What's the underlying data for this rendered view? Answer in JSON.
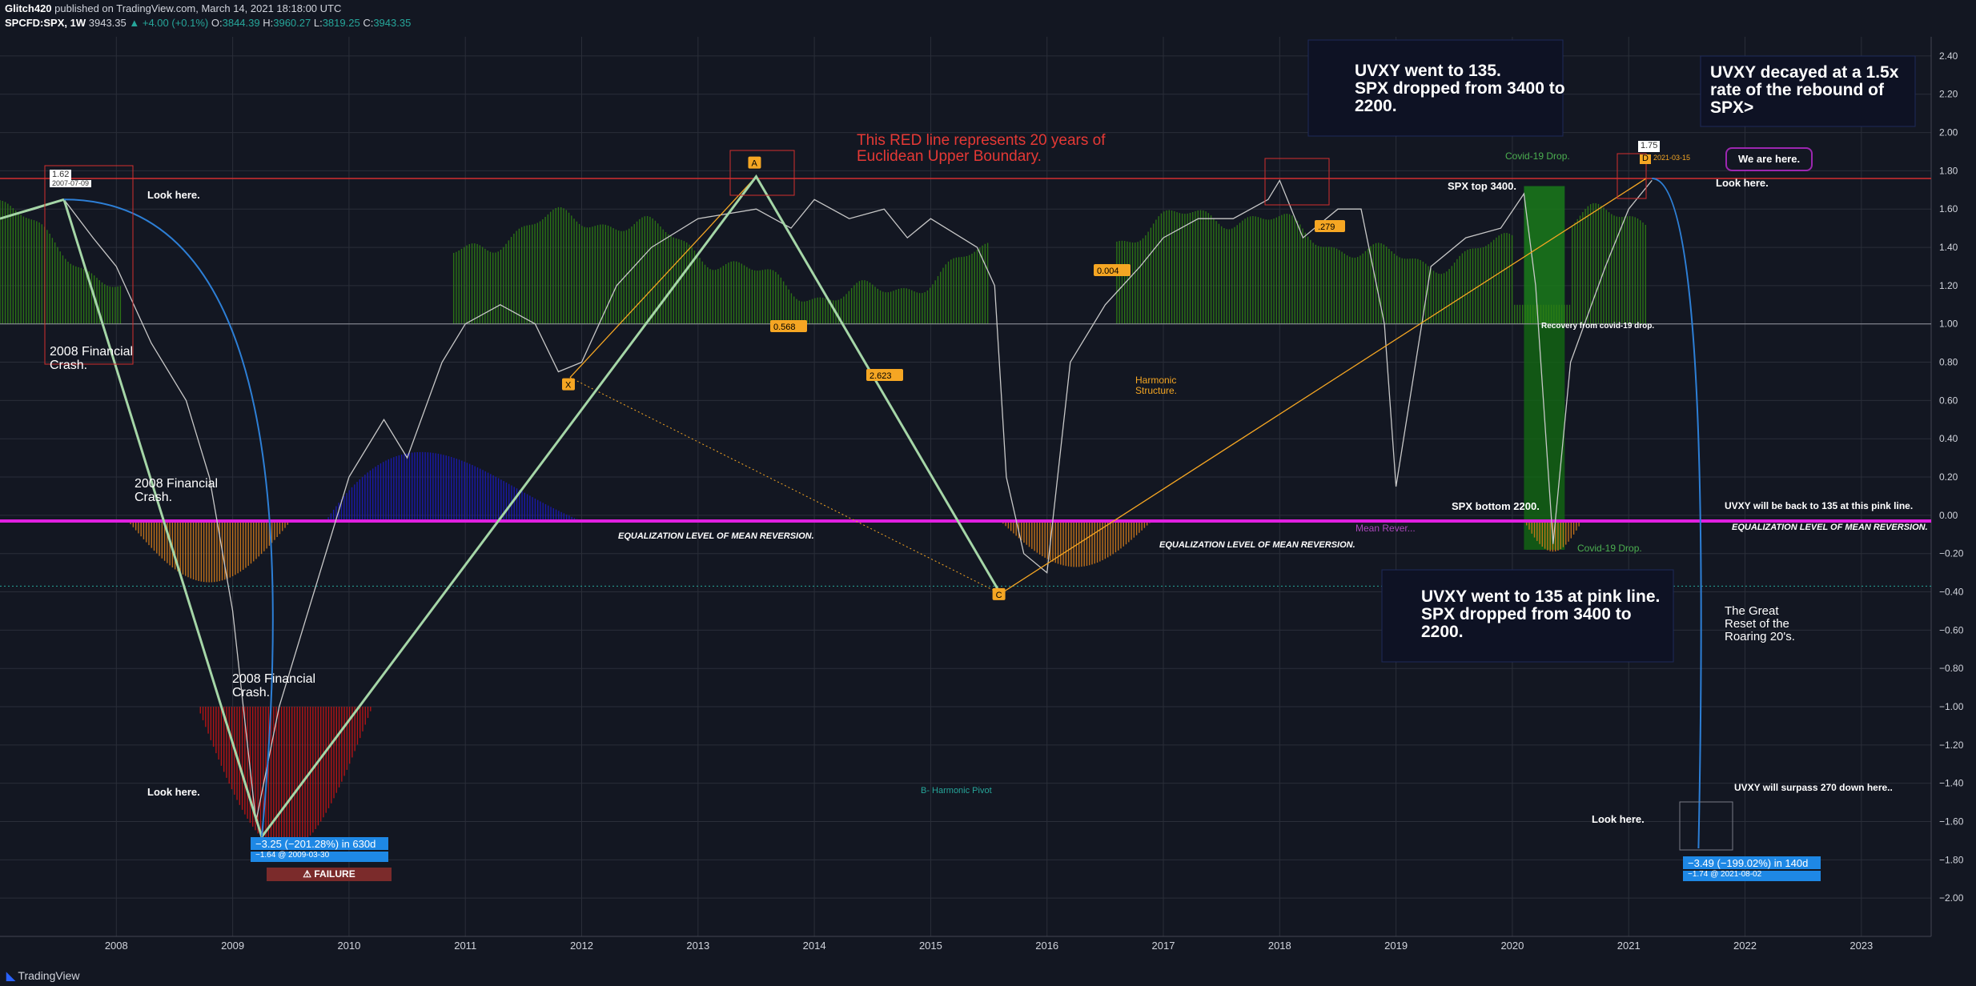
{
  "header": {
    "publisher": "Glitch420",
    "published_text": "published on TradingView.com, March 14, 2021 18:18:00 UTC",
    "symbol": "SPCFD:SPX, 1W",
    "last": "3943.35",
    "change": "▲ +4.00 (+0.1%)",
    "o_label": "O:",
    "o": "3844.39",
    "h_label": "H:",
    "h": "3960.27",
    "l_label": "L:",
    "l": "3819.25",
    "c_label": "C:",
    "c": "3943.35"
  },
  "footer": {
    "brand": "TradingView"
  },
  "colors": {
    "background": "#131722",
    "grid": "#2a2e39",
    "price": "#c8c8c8",
    "green_hist": "#2e7d14",
    "orange_hist": "#d17a1a",
    "blue_hist": "#1a1ab8",
    "red_hist": "#c41414",
    "pink_line": "#e020e0",
    "red_line": "#d32f2f",
    "pattern": "#a5d6a7",
    "harmonic": "#f5a623",
    "arc": "#2d7fd6"
  },
  "annotations": {
    "uvxy_135_top": "UVXY went to 135.\nSPX dropped from 3400 to\n2200.",
    "uvxy_decay": "UVXY decayed at a 1.5x\nrate of the rebound of\nSPX>",
    "red_line_text": "This RED line represents 20 years of\nEuclidean Upper Boundary.",
    "look_here_1": "Look here.",
    "look_here_2": "Look here.",
    "look_here_3": "Look here.",
    "look_here_4": "Look here.",
    "crash_1": "2008 Financial\nCrash.",
    "crash_2": "2008 Financial\nCrash.",
    "crash_3": "2008 Financial\nCrash.",
    "covid_drop_top": "Covid-19 Drop.",
    "covid_drop_bottom": "Covid-19 Drop.",
    "spx_top": "SPX top 3400.",
    "spx_bottom": "SPX bottom 2200.",
    "recovery": "Recovery from covid-19 drop.",
    "we_are_here": "We are here.",
    "uvxy_back": "UVXY will be back to 135 at this pink line.",
    "equal_1": "EQUALIZATION LEVEL OF MEAN REVERSION.",
    "equal_2": "EQUALIZATION LEVEL OF MEAN REVERSION.",
    "equal_3": "EQUALIZATION LEVEL OF MEAN REVERSION.",
    "mean_rev": "Mean Rever...",
    "harmonic_structure": "Harmonic\nStructure.",
    "harmonic_pivot": "B- Harmonic Pivot",
    "uvxy_135_pink": "UVXY went to 135 at pink line.\nSPX dropped from 3400 to\n2200.",
    "great_reset": "The Great\nReset of the\nRoaring 20's.",
    "surpass_270": "UVXY will surpass 270 down here..",
    "measure_1_main": "−3.25 (−201.28%) in 630d",
    "measure_1_sub": "−1.64 @ 2009-03-30",
    "failure": "⚠ FAILURE",
    "measure_2_main": "−3.49 (−199.02%) in 140d",
    "measure_2_sub": "−1.74 @ 2021-08-02",
    "peak_val": "1.62",
    "peak_date": "2007-07-09",
    "last_val": "1.75",
    "last_date": "2021-03-15",
    "label_x": "X",
    "label_a": "A",
    "label_c": "C",
    "label_d": "D",
    "ratio_568": "0.568",
    "ratio_2623": "2.623",
    "ratio_004": "0.004",
    "ratio_279": ".279"
  },
  "chart_data": {
    "type": "line",
    "title": "",
    "xlabel": "",
    "ylabel": "",
    "x_ticks": [
      "2008",
      "2009",
      "2010",
      "2011",
      "2012",
      "2013",
      "2014",
      "2015",
      "2016",
      "2017",
      "2018",
      "2019",
      "2020",
      "2021",
      "2022",
      "2023"
    ],
    "y_ticks": [
      "2.40",
      "2.20",
      "2.00",
      "1.80",
      "1.60",
      "1.40",
      "1.20",
      "1.00",
      "0.80",
      "0.60",
      "0.40",
      "0.20",
      "0.00",
      "−0.20",
      "−0.40",
      "−0.60",
      "−0.80",
      "−1.00",
      "−1.20",
      "−1.40",
      "−1.60",
      "−1.80",
      "−2.00"
    ],
    "xlim": [
      2007.0,
      2023.6
    ],
    "ylim": [
      -2.2,
      2.5
    ],
    "grid": true,
    "reference_lines": {
      "upper_boundary": 1.76,
      "mean_reversion": -0.03,
      "base": 1.0,
      "dotted_low": -0.37
    },
    "price_series": {
      "x": [
        2007.0,
        2007.3,
        2007.55,
        2007.8,
        2008.0,
        2008.3,
        2008.6,
        2008.8,
        2009.0,
        2009.2,
        2009.4,
        2009.7,
        2010.0,
        2010.3,
        2010.5,
        2010.8,
        2011.0,
        2011.3,
        2011.6,
        2011.8,
        2012.0,
        2012.3,
        2012.6,
        2013.0,
        2013.5,
        2013.8,
        2014.0,
        2014.3,
        2014.6,
        2014.8,
        2015.0,
        2015.4,
        2015.55,
        2015.65,
        2015.8,
        2016.0,
        2016.2,
        2016.5,
        2016.8,
        2017.0,
        2017.3,
        2017.6,
        2017.9,
        2018.0,
        2018.2,
        2018.5,
        2018.7,
        2018.9,
        2019.0,
        2019.3,
        2019.6,
        2019.9,
        2020.1,
        2020.2,
        2020.35,
        2020.5,
        2020.8,
        2021.0,
        2021.2
      ],
      "y": [
        1.55,
        1.6,
        1.65,
        1.45,
        1.3,
        0.9,
        0.6,
        0.2,
        -0.5,
        -1.6,
        -1.0,
        -0.4,
        0.2,
        0.5,
        0.3,
        0.8,
        1.0,
        1.1,
        1.0,
        0.75,
        0.8,
        1.2,
        1.4,
        1.55,
        1.6,
        1.5,
        1.65,
        1.55,
        1.6,
        1.45,
        1.55,
        1.4,
        1.2,
        0.2,
        -0.2,
        -0.3,
        0.8,
        1.1,
        1.3,
        1.45,
        1.55,
        1.55,
        1.65,
        1.75,
        1.45,
        1.6,
        1.6,
        1.0,
        0.15,
        1.3,
        1.45,
        1.5,
        1.68,
        1.2,
        -0.15,
        0.8,
        1.3,
        1.6,
        1.75
      ]
    },
    "xabcd_pattern": {
      "x": [
        2007.55,
        2009.25,
        2013.5,
        2015.6
      ],
      "y": [
        1.65,
        -1.68,
        1.77,
        -0.41
      ]
    },
    "harmonic_pattern": {
      "x": [
        2011.9,
        2013.5,
        2015.6,
        2021.15
      ],
      "y": [
        0.72,
        1.77,
        -0.41,
        1.76
      ],
      "ratios": [
        "0.568",
        "2.623",
        "0.004",
        ".279"
      ]
    },
    "projection_arcs": [
      {
        "from": [
          2007.55,
          1.65
        ],
        "to": [
          2009.25,
          -1.68
        ],
        "label": "−3.25 (−201.28%) in 630d"
      },
      {
        "from": [
          2021.2,
          1.76
        ],
        "to": [
          2021.6,
          -1.74
        ],
        "label": "−3.49 (−199.02%) in 140d"
      }
    ]
  }
}
